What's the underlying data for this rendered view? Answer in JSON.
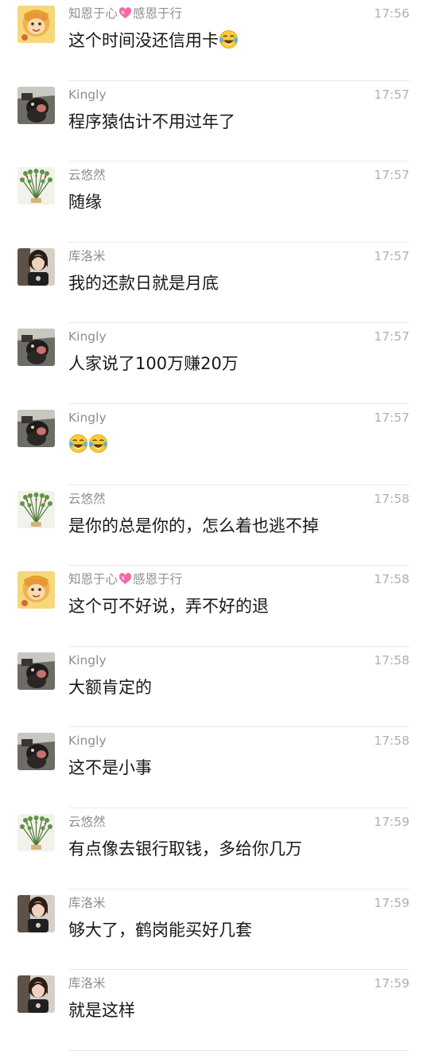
{
  "messages": [
    {
      "avatar": "monkey-king",
      "name_parts": [
        "知恩于心",
        "感恩于行"
      ],
      "name_heart": true,
      "time": "17:56",
      "text": "这个时间没还信用卡",
      "emojis": 1
    },
    {
      "avatar": "dog-photo",
      "name": "Kingly",
      "time": "17:57",
      "text": "程序猿估计不用过年了",
      "emojis": 0
    },
    {
      "avatar": "plant",
      "name": "云悠然",
      "time": "17:57",
      "text": "随缘",
      "emojis": 0
    },
    {
      "avatar": "woman",
      "name": "库洛米",
      "time": "17:57",
      "text": "我的还款日就是月底",
      "emojis": 0
    },
    {
      "avatar": "dog-photo",
      "name": "Kingly",
      "time": "17:57",
      "text": "人家说了100万赚20万",
      "emojis": 0
    },
    {
      "avatar": "dog-photo",
      "name": "Kingly",
      "time": "17:57",
      "text": "",
      "emojis": 2
    },
    {
      "avatar": "plant",
      "name": "云悠然",
      "time": "17:58",
      "text": "是你的总是你的，怎么着也逃不掉",
      "emojis": 0
    },
    {
      "avatar": "monkey-king",
      "name_parts": [
        "知恩于心",
        "感恩于行"
      ],
      "name_heart": true,
      "time": "17:58",
      "text": "这个可不好说，弄不好的退",
      "emojis": 0
    },
    {
      "avatar": "dog-photo",
      "name": "Kingly",
      "time": "17:58",
      "text": "大额肯定的",
      "emojis": 0
    },
    {
      "avatar": "dog-photo",
      "name": "Kingly",
      "time": "17:58",
      "text": "这不是小事",
      "emojis": 0
    },
    {
      "avatar": "plant",
      "name": "云悠然",
      "time": "17:59",
      "text": "有点像去银行取钱，多给你几万",
      "emojis": 0
    },
    {
      "avatar": "woman",
      "name": "库洛米",
      "time": "17:59",
      "text": "够大了，鹤岗能买好几套",
      "emojis": 0
    },
    {
      "avatar": "woman",
      "name": "库洛米",
      "time": "17:59",
      "text": "就是这样",
      "emojis": 0
    }
  ],
  "icons": {
    "emoji": "tears-of-joy-emoji",
    "heart": "pink-heart-icon"
  },
  "colors": {
    "name": "#8e8e8e",
    "time": "#b0b0b0",
    "message": "#181818",
    "divider": "#e9e9e9"
  }
}
